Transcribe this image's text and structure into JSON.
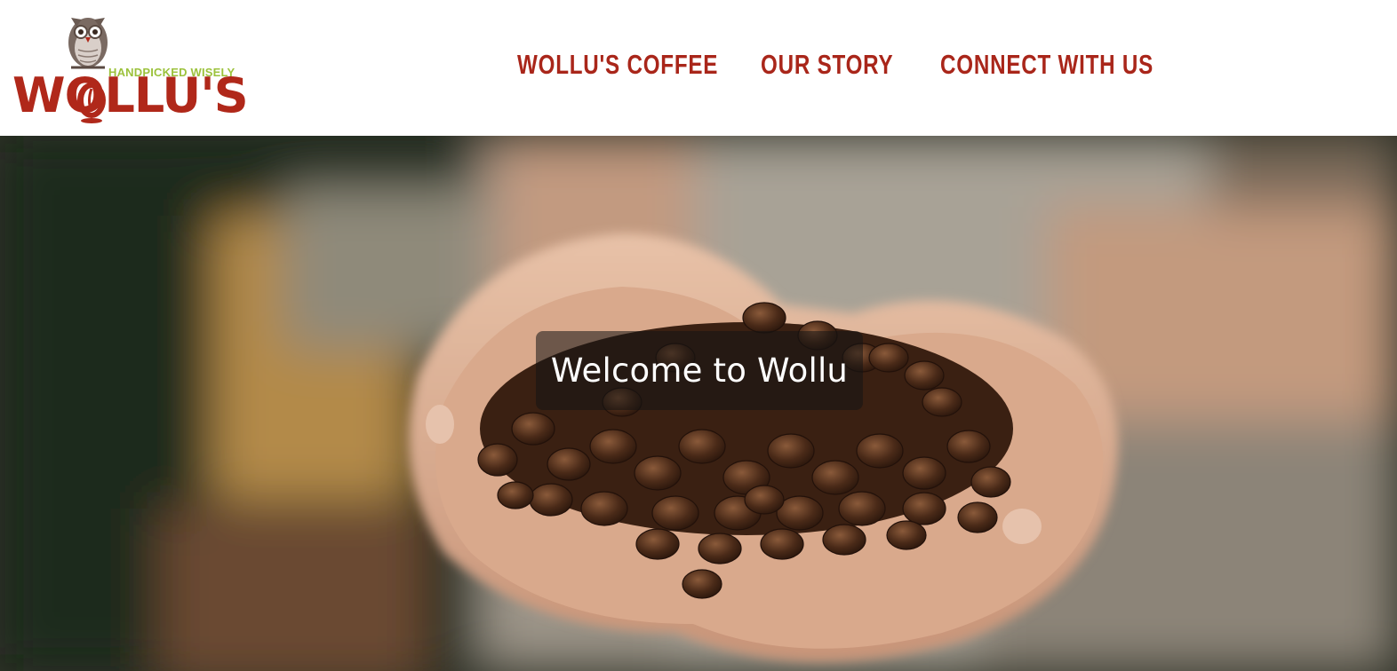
{
  "header": {
    "logo": {
      "tagline": "HANDPICKED WISELY",
      "wordmark": "WOLLU'S",
      "icon": "owl-icon"
    },
    "nav": [
      {
        "label": "WOLLU'S COFFEE"
      },
      {
        "label": "OUR STORY"
      },
      {
        "label": "CONNECT WITH US"
      }
    ]
  },
  "hero": {
    "image": "hands-holding-coffee-beans",
    "caption": "Welcome to Wollu"
  },
  "colors": {
    "brand_red": "#a9261a",
    "tagline_green": "#9cc23c",
    "header_bg": "#ffffff"
  }
}
